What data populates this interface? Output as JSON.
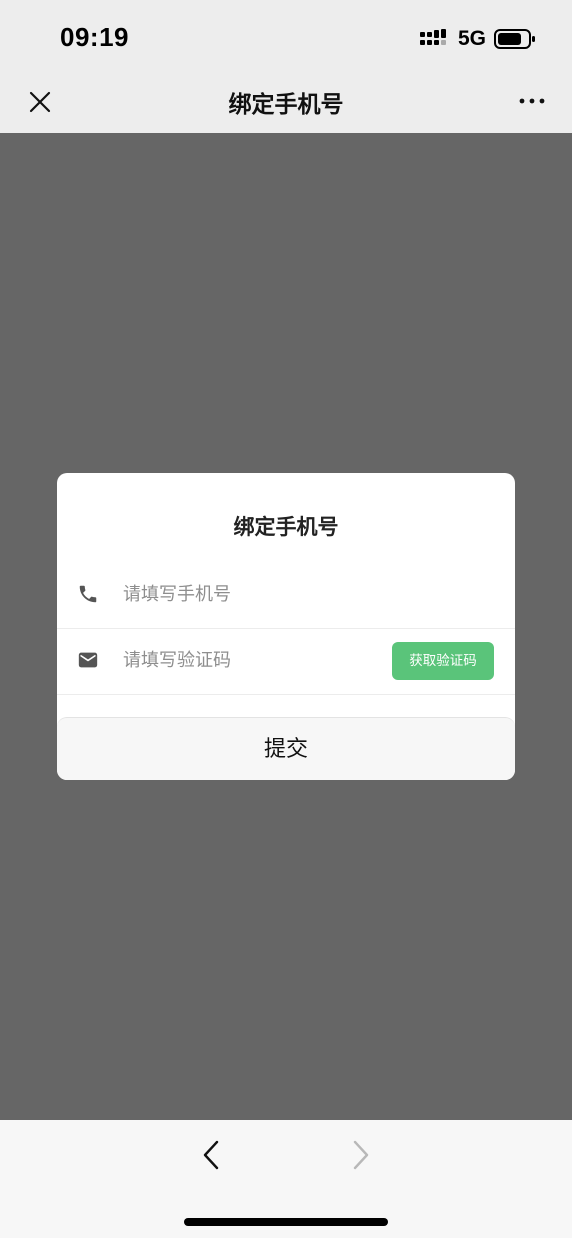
{
  "status_bar": {
    "time": "09:19",
    "network": "5G"
  },
  "nav": {
    "title": "绑定手机号"
  },
  "dialog": {
    "title": "绑定手机号",
    "phone_placeholder": "请填写手机号",
    "code_placeholder": "请填写验证码",
    "get_code_label": "获取验证码",
    "submit_label": "提交"
  },
  "colors": {
    "accent_green": "#5ac47a",
    "overlay": "#666666"
  },
  "icons": [
    "signal-icon",
    "battery-icon",
    "close-icon",
    "more-icon",
    "phone-icon",
    "mail-icon",
    "chevron-left-icon",
    "chevron-right-icon"
  ]
}
